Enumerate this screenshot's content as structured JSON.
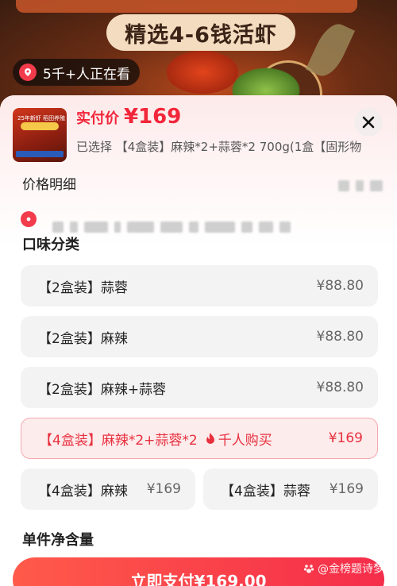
{
  "banner": {
    "slogan": "精选4-6钱活虾",
    "viewers": "5千+人正在看"
  },
  "product": {
    "thumb_text": "25年新虾 稻田养殖",
    "price_label": "实付价",
    "price": "¥169",
    "selected_text": "已选择 【4盒装】麻辣*2+蒜蓉*2 700g(1盒【固形物"
  },
  "price_detail_label": "价格明细",
  "section_flavor": "口味分类",
  "options": [
    {
      "label": "【2盒装】蒜蓉",
      "price": "¥88.80"
    },
    {
      "label": "【2盒装】麻辣",
      "price": "¥88.80"
    },
    {
      "label": "【2盒装】麻辣+蒜蓉",
      "price": "¥88.80"
    },
    {
      "label": "【4盒装】麻辣*2+蒜蓉*2",
      "hot": "千人购买",
      "price": "¥169"
    },
    {
      "label": "【4盒装】麻辣",
      "price": "¥169"
    },
    {
      "label": "【4盒装】蒜蓉",
      "price": "¥169"
    }
  ],
  "section_weight": "单件净含量",
  "pay_button": "立即支付¥169.00",
  "watermark": "@金榜题诗梦",
  "colors": {
    "accent": "#f2263a",
    "pin": "#f23b4b"
  }
}
